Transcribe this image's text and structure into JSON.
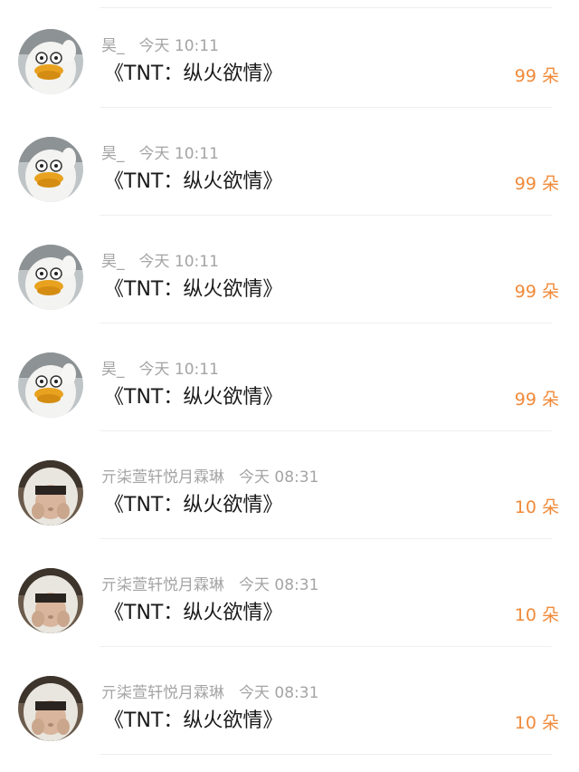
{
  "gifts": [
    {
      "name": "昊_",
      "time": "今天 10:11",
      "gift": "《TNT：纵火欲情》",
      "count": "99 朵",
      "avatar_icon": "duck-avatar-icon"
    },
    {
      "name": "昊_",
      "time": "今天 10:11",
      "gift": "《TNT：纵火欲情》",
      "count": "99 朵",
      "avatar_icon": "duck-avatar-icon"
    },
    {
      "name": "昊_",
      "time": "今天 10:11",
      "gift": "《TNT：纵火欲情》",
      "count": "99 朵",
      "avatar_icon": "duck-avatar-icon"
    },
    {
      "name": "昊_",
      "time": "今天 10:11",
      "gift": "《TNT：纵火欲情》",
      "count": "99 朵",
      "avatar_icon": "duck-avatar-icon"
    },
    {
      "name": "亓柒萱轩悦月霖琳",
      "time": "今天 08:31",
      "gift": "《TNT：纵火欲情》",
      "count": "10 朵",
      "avatar_icon": "hooded-person-avatar-icon"
    },
    {
      "name": "亓柒萱轩悦月霖琳",
      "time": "今天 08:31",
      "gift": "《TNT：纵火欲情》",
      "count": "10 朵",
      "avatar_icon": "hooded-person-avatar-icon"
    },
    {
      "name": "亓柒萱轩悦月霖琳",
      "time": "今天 08:31",
      "gift": "《TNT：纵火欲情》",
      "count": "10 朵",
      "avatar_icon": "hooded-person-avatar-icon"
    }
  ],
  "colors": {
    "count_accent": "#f08a3a",
    "meta_text": "#a4a4a4",
    "gift_text": "#1a1a1a",
    "divider": "#efefef"
  }
}
